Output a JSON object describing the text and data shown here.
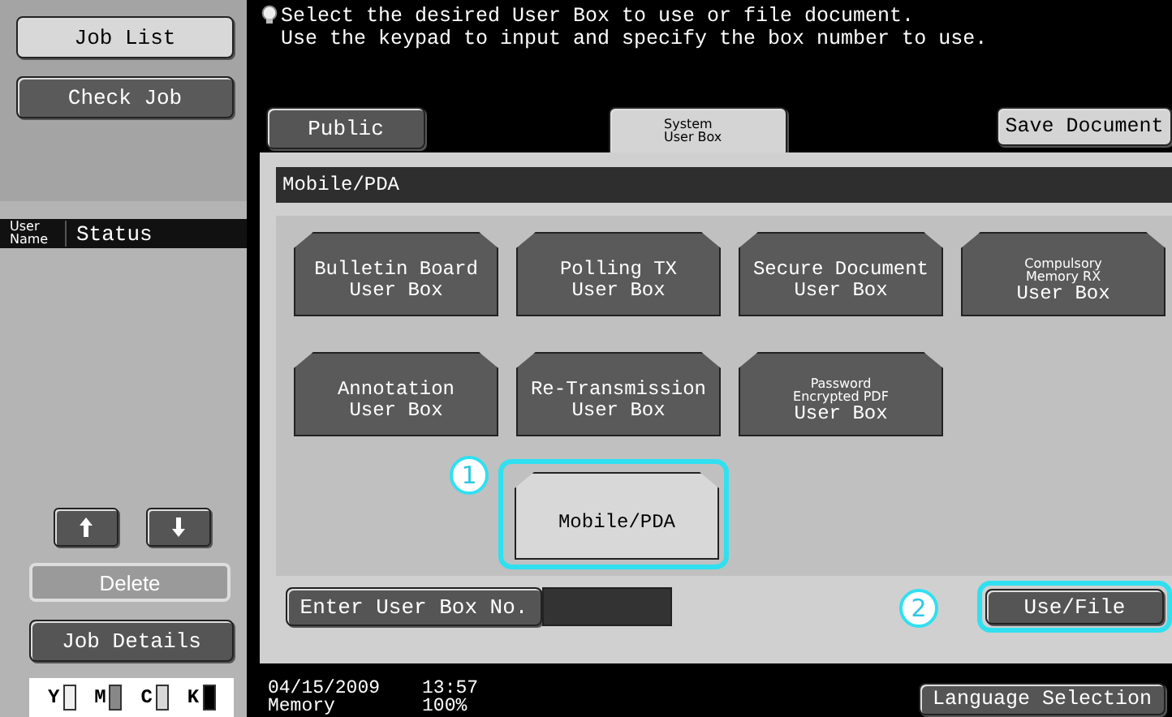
{
  "sidebar": {
    "tabs": [
      {
        "label": "Job List",
        "selected": true
      },
      {
        "label": "Check Job",
        "selected": false
      }
    ],
    "columns": [
      {
        "label": "User Name",
        "kind": "small"
      },
      {
        "label": "Status",
        "kind": "normal"
      }
    ],
    "delete_button": {
      "label": "Delete",
      "disabled": true
    },
    "job_details_button": {
      "label": "Job Details"
    },
    "toner": [
      {
        "label": "Y",
        "color": "#f0f0f0"
      },
      {
        "label": "M",
        "color": "#888888"
      },
      {
        "label": "C",
        "color": "#d8d8d8"
      },
      {
        "label": "K",
        "color": "#000000"
      }
    ]
  },
  "message": [
    "Select the desired User Box to use or file document.",
    "Use the keypad to input and specify the box number to use."
  ],
  "tabs": [
    {
      "label": "Public",
      "kind": "normal",
      "selected": false
    },
    {
      "label": "System User Box",
      "kind": "small",
      "selected": true
    }
  ],
  "save_button": "Save Document",
  "breadcrumb": "Mobile/PDA",
  "boxes": [
    {
      "lines": [
        "Bulletin Board",
        "User Box"
      ],
      "selected": false
    },
    {
      "lines": [
        "Polling TX",
        "User Box"
      ],
      "selected": false
    },
    {
      "lines": [
        "Secure Document",
        "User Box"
      ],
      "selected": false
    },
    {
      "small": [
        "Compulsory",
        "Memory RX"
      ],
      "lines": [
        "User Box"
      ],
      "selected": false
    },
    {
      "lines": [
        "Annotation",
        "User Box"
      ],
      "selected": false
    },
    {
      "lines": [
        "Re-Transmission",
        "User Box"
      ],
      "selected": false
    },
    {
      "small": [
        "Password",
        "Encrypted PDF"
      ],
      "lines": [
        "User Box"
      ],
      "selected": false
    }
  ],
  "mobile_box": {
    "label": "Mobile/PDA",
    "callout": "1"
  },
  "enter_box_button": "Enter User Box No.",
  "use_file_button": {
    "label": "Use/File",
    "callout": "2"
  },
  "status_bar": {
    "date": "04/15/2009",
    "time": "13:57",
    "memory_label": "Memory",
    "memory_value": "100%",
    "language_button": "Language Selection"
  }
}
